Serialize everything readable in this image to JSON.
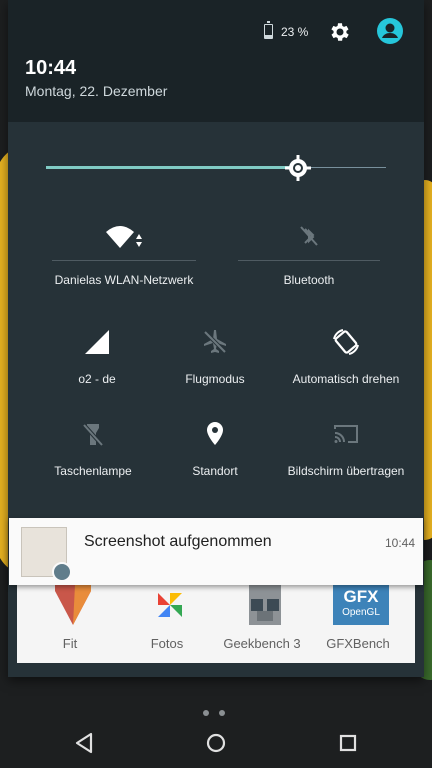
{
  "status": {
    "battery_text": "23 %",
    "battery_level": 0.23
  },
  "header": {
    "time": "10:44",
    "date": "Montag, 22. Dezember"
  },
  "brightness": {
    "level": 0.74
  },
  "tiles": {
    "wifi": "Danielas WLAN-Netzwerk",
    "bluetooth": "Bluetooth",
    "cellular": "o2 - de",
    "airplane": "Flugmodus",
    "rotate": "Automatisch drehen",
    "flashlight": "Taschenlampe",
    "location": "Standort",
    "cast": "Bildschirm übertragen"
  },
  "notification": {
    "title": "Screenshot aufgenommen",
    "time": "10:44"
  },
  "apps": [
    "Fit",
    "Fotos",
    "Geekbench 3",
    "GFXBench"
  ],
  "apps_logo_text": [
    "GFX",
    "OpenGL"
  ],
  "colors": {
    "accent": "#80cbc4",
    "avatar": "#26c6da",
    "shade": "#263238"
  }
}
